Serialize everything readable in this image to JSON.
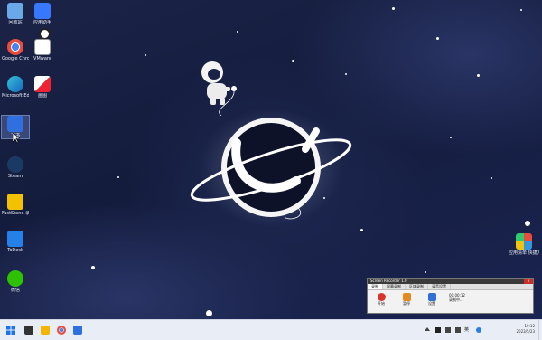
{
  "desktop": {
    "icons": [
      {
        "label": "回收站",
        "color": "#6aa8e8"
      },
      {
        "label": "Google Chrome",
        "color": "#e94b3c"
      },
      {
        "label": "Microsoft Edge",
        "color": "#1fa3c8"
      },
      {
        "label": "飞书",
        "color": "#2f6fe0"
      },
      {
        "label": "Steam",
        "color": "#1b3a63"
      },
      {
        "label": "FastStone 录屏",
        "color": "#f2c200"
      },
      {
        "label": "ToDesk",
        "color": "#2580e8"
      },
      {
        "label": "微信",
        "color": "#2dc100"
      },
      {
        "label": "应用助手",
        "color": "#3778ff"
      },
      {
        "label": "VMware",
        "color": "#777777"
      },
      {
        "label": "画图",
        "color": "#f6f6f6"
      }
    ],
    "right_icon": {
      "label": "应用清单 快捷方式",
      "color": "#e74c3c"
    }
  },
  "recorder": {
    "title": "Screen Recorder 1.0",
    "close": "×",
    "tabs": [
      "录制",
      "屏幕录制",
      "区域录制",
      "录音设置"
    ],
    "buttons": [
      {
        "label": "开始",
        "color": "#d9342b"
      },
      {
        "label": "暂停",
        "color": "#e58a1f"
      },
      {
        "label": "设置",
        "color": "#2f6fd6"
      }
    ],
    "timer": "00:00:12",
    "status": "录制中..."
  },
  "taskbar": {
    "apps": [
      {
        "name": "start",
        "color": "#1a73e8"
      },
      {
        "name": "task-view",
        "color": "#333333"
      },
      {
        "name": "explorer",
        "color": "#f4b400"
      },
      {
        "name": "chrome",
        "color": "#e94b3c"
      },
      {
        "name": "feishu",
        "color": "#2f6fe0"
      }
    ],
    "tray_lang": "英",
    "clock_time": "19:12",
    "clock_date": "2023/5/23"
  }
}
